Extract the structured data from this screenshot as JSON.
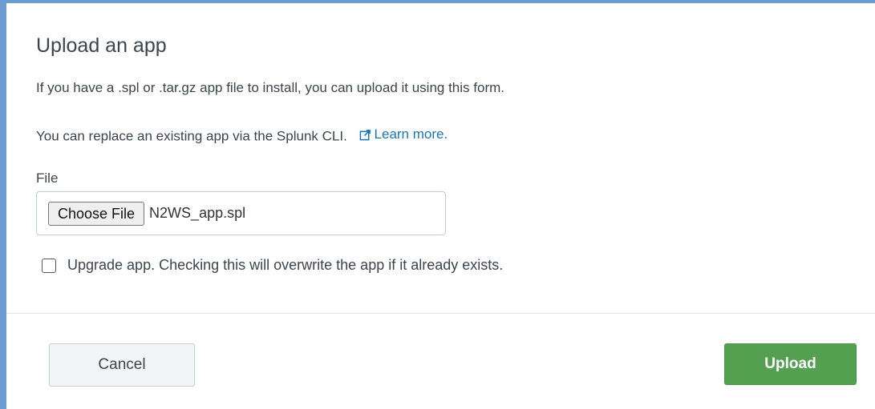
{
  "dialog": {
    "title": "Upload an app",
    "description": "If you have a .spl or .tar.gz app file to install, you can upload it using this form.",
    "replace_text": "You can replace an existing app via the Splunk CLI.",
    "learn_more_label": "Learn more.",
    "learn_more_icon": "external-link-icon",
    "link_color": "#1a75b7"
  },
  "file_input": {
    "label": "File",
    "choose_button_label": "Choose File",
    "selected_file": "N2WS_app.spl"
  },
  "upgrade": {
    "checked": false,
    "label": "Upgrade app. Checking this will overwrite the app if it already exists."
  },
  "footer": {
    "cancel_label": "Cancel",
    "upload_label": "Upload",
    "upload_color": "#53a051"
  }
}
